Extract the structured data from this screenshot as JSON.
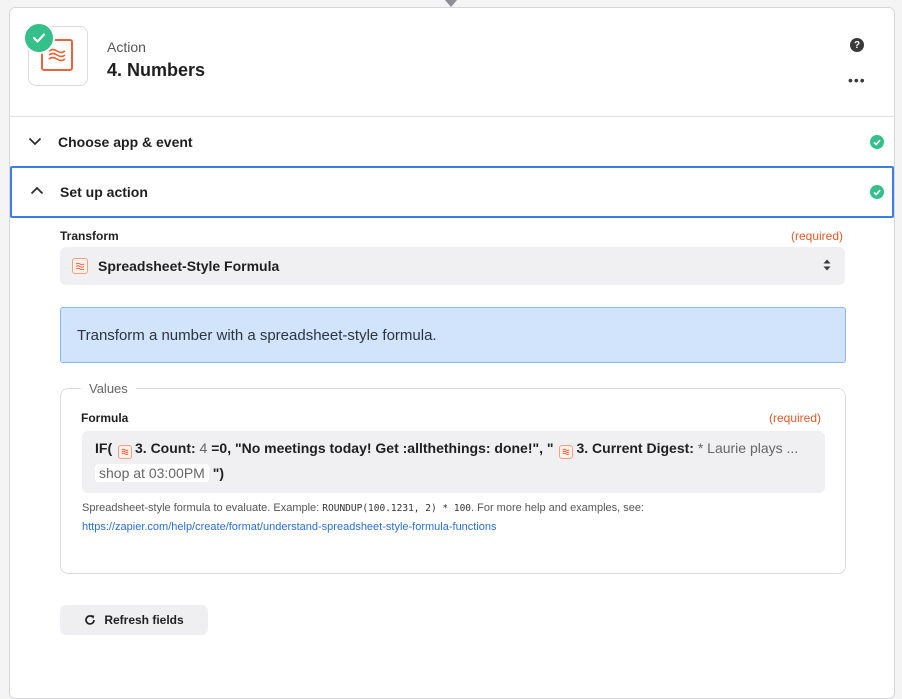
{
  "header": {
    "step_type": "Action",
    "step_title": "4. Numbers",
    "help_icon": "question-circle-icon",
    "more_icon": "more-horizontal-icon"
  },
  "sections": {
    "choose_app": {
      "title": "Choose app & event",
      "status": "complete"
    },
    "setup_action": {
      "title": "Set up action",
      "status": "complete"
    }
  },
  "transform": {
    "label": "Transform",
    "required": "(required)",
    "value": "Spreadsheet-Style Formula"
  },
  "info": {
    "text": "Transform a number with a spreadsheet-style formula."
  },
  "values": {
    "legend": "Values",
    "formula": {
      "label": "Formula",
      "required": "(required)",
      "line1_start": "IF(",
      "pill1_label": "3. Count:",
      "pill1_value": "4",
      "line1_mid": "=0, \"No meetings today! Get :allthethings: done!\", \"",
      "pill2_label": "3. Current Digest:",
      "pill2_value": "* Laurie plays ...",
      "line2_pill_end": "shop at 03:00PM",
      "line2_end": "\")"
    },
    "help_prefix": "Spreadsheet-style formula to evaluate. Example: ",
    "help_code": "ROUNDUP(100.1231, 2) * 100",
    "help_suffix": ". For more help and examples, see:",
    "help_link": "https://zapier.com/help/create/format/understand-spreadsheet-style-formula-functions"
  },
  "refresh": {
    "label": "Refresh fields"
  },
  "colors": {
    "accent": "#3b7ee6",
    "success": "#35c08b",
    "brand": "#e8643a",
    "info_bg": "#d2e4fb",
    "required": "#e05a28"
  }
}
